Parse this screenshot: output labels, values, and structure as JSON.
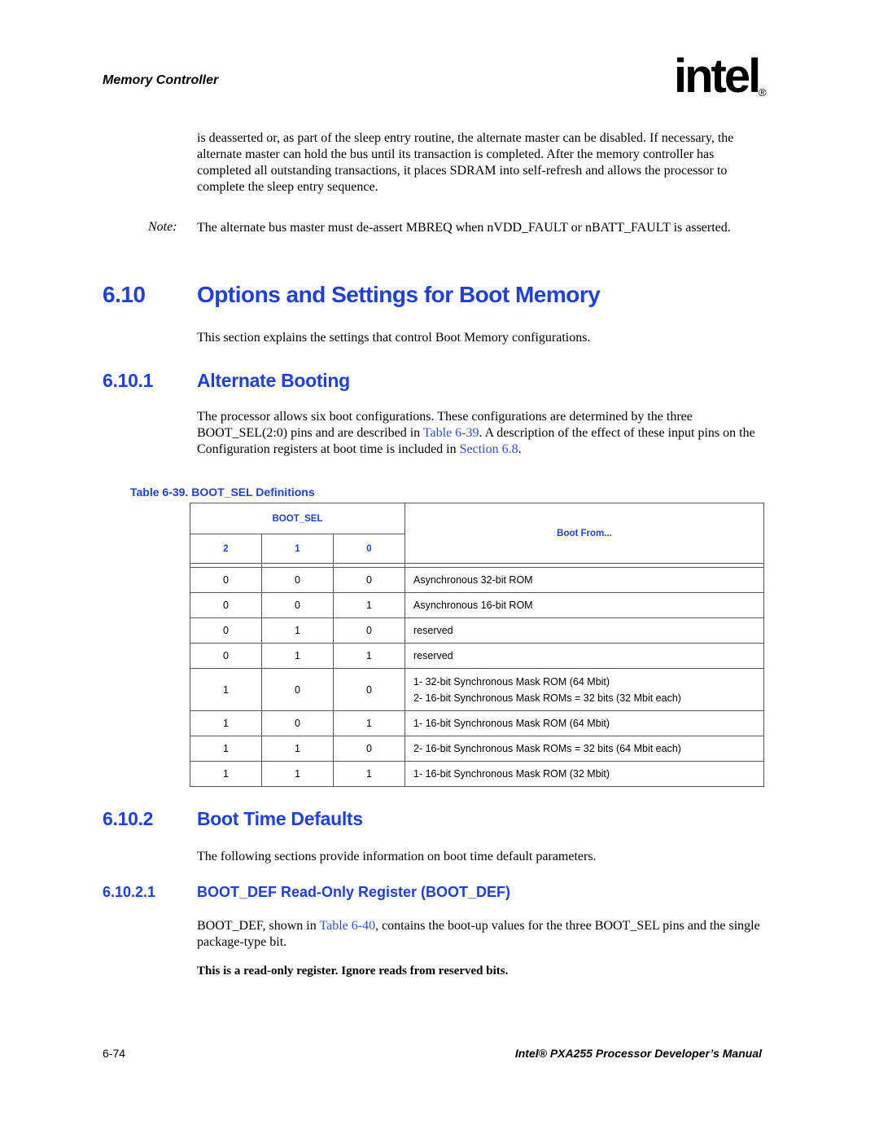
{
  "header": {
    "running_head": "Memory Controller",
    "logo_text": "intel",
    "logo_reg": "®"
  },
  "intro": {
    "paragraph": "is deasserted or, as part of the sleep entry routine, the alternate master can be disabled. If necessary, the alternate master can hold the bus until its transaction is completed. After the memory controller has completed all outstanding transactions, it places SDRAM into self-refresh and allows the processor to complete the sleep entry sequence.",
    "note_label": "Note:",
    "note_text": "The alternate bus master must de-assert MBREQ when nVDD_FAULT or nBATT_FAULT is asserted."
  },
  "section_6_10": {
    "number": "6.10",
    "title": "Options and Settings for Boot Memory",
    "text": "This section explains the settings that control Boot Memory configurations."
  },
  "section_6_10_1": {
    "number": "6.10.1",
    "title": "Alternate Booting",
    "text_1": "The processor allows six boot configurations. These configurations are determined by the three BOOT_SEL(2:0) pins and are described in ",
    "link_table": "Table 6-39",
    "text_2": ". A description of the effect of these input pins on the Configuration registers at boot time is included in ",
    "link_section": "Section 6.8",
    "text_3": "."
  },
  "table_6_39": {
    "caption": "Table 6-39. BOOT_SEL Definitions",
    "header_group": "BOOT_SEL",
    "header_bits": [
      "2",
      "1",
      "0"
    ],
    "header_boot_from": "Boot From...",
    "rows": [
      {
        "b2": "0",
        "b1": "0",
        "b0": "0",
        "line1": "Asynchronous 32-bit ROM",
        "line2": ""
      },
      {
        "b2": "0",
        "b1": "0",
        "b0": "1",
        "line1": "Asynchronous 16-bit ROM",
        "line2": ""
      },
      {
        "b2": "0",
        "b1": "1",
        "b0": "0",
        "line1": "reserved",
        "line2": ""
      },
      {
        "b2": "0",
        "b1": "1",
        "b0": "1",
        "line1": "reserved",
        "line2": ""
      },
      {
        "b2": "1",
        "b1": "0",
        "b0": "0",
        "line1": "1- 32-bit Synchronous Mask ROM (64 Mbit)",
        "line2": "2- 16-bit Synchronous Mask ROMs = 32 bits (32 Mbit each)"
      },
      {
        "b2": "1",
        "b1": "0",
        "b0": "1",
        "line1": "1- 16-bit Synchronous Mask ROM (64 Mbit)",
        "line2": ""
      },
      {
        "b2": "1",
        "b1": "1",
        "b0": "0",
        "line1": "2- 16-bit Synchronous Mask ROMs = 32 bits (64 Mbit each)",
        "line2": ""
      },
      {
        "b2": "1",
        "b1": "1",
        "b0": "1",
        "line1": "1- 16-bit Synchronous Mask ROM (32 Mbit)",
        "line2": ""
      }
    ]
  },
  "section_6_10_2": {
    "number": "6.10.2",
    "title": "Boot Time Defaults",
    "text": "The following sections provide information on boot time default parameters."
  },
  "section_6_10_2_1": {
    "number": "6.10.2.1",
    "title": "BOOT_DEF Read-Only Register (BOOT_DEF)",
    "text_1": "BOOT_DEF, shown in ",
    "link_table": "Table 6-40",
    "text_2": ", contains the boot-up values for the three BOOT_SEL pins and the single package-type bit.",
    "bold_note": "This is a read-only register. Ignore reads from reserved bits."
  },
  "footer": {
    "page_number": "6-74",
    "manual_title": "Intel® PXA255 Processor Developer’s Manual"
  }
}
